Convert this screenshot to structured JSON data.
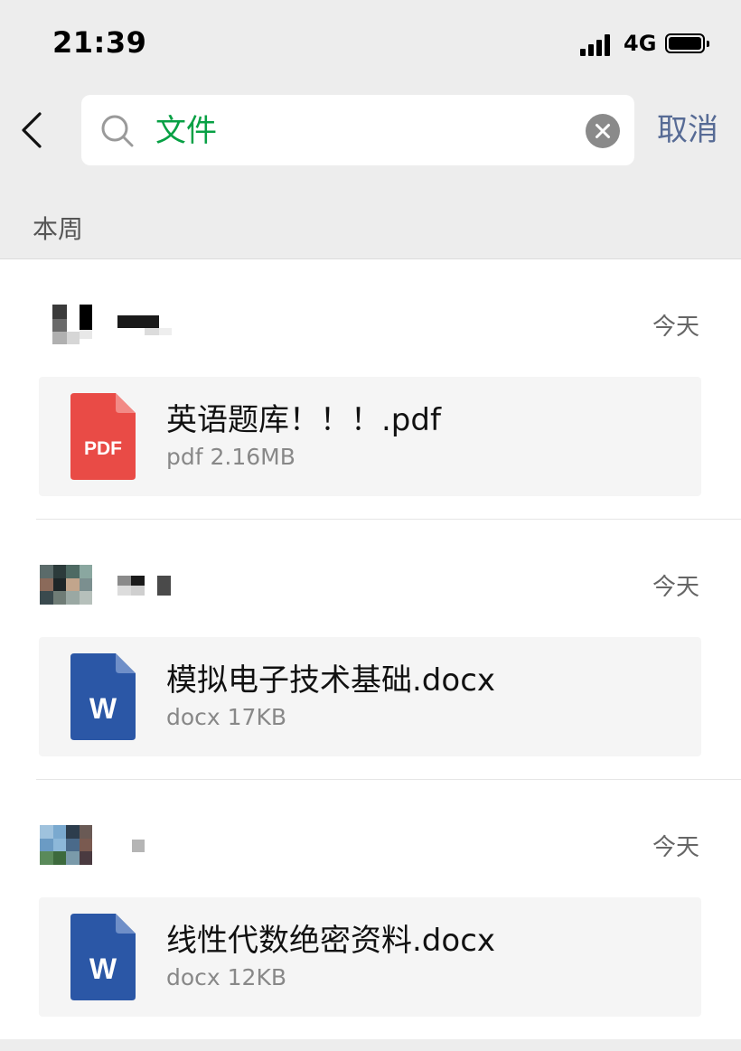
{
  "status_bar": {
    "time": "21:39",
    "network": "4G"
  },
  "search": {
    "query": "文件",
    "cancel_label": "取消"
  },
  "section": {
    "title": "本周"
  },
  "results": [
    {
      "date": "今天",
      "file": {
        "name": "英语题库！！！.pdf",
        "meta": "pdf 2.16MB",
        "type": "pdf",
        "icon_label": "PDF",
        "icon_color": "#e94b46"
      }
    },
    {
      "date": "今天",
      "file": {
        "name": "模拟电子技术基础.docx",
        "meta": "docx 17KB",
        "type": "docx",
        "icon_label": "W",
        "icon_color": "#2b57a6"
      }
    },
    {
      "date": "今天",
      "file": {
        "name": "线性代数绝密资料.docx",
        "meta": "docx 12KB",
        "type": "docx",
        "icon_label": "W",
        "icon_color": "#2b57a6"
      }
    }
  ],
  "colors": {
    "accent_green": "#07a044",
    "link_blue": "#576b95",
    "background": "#ededed"
  }
}
